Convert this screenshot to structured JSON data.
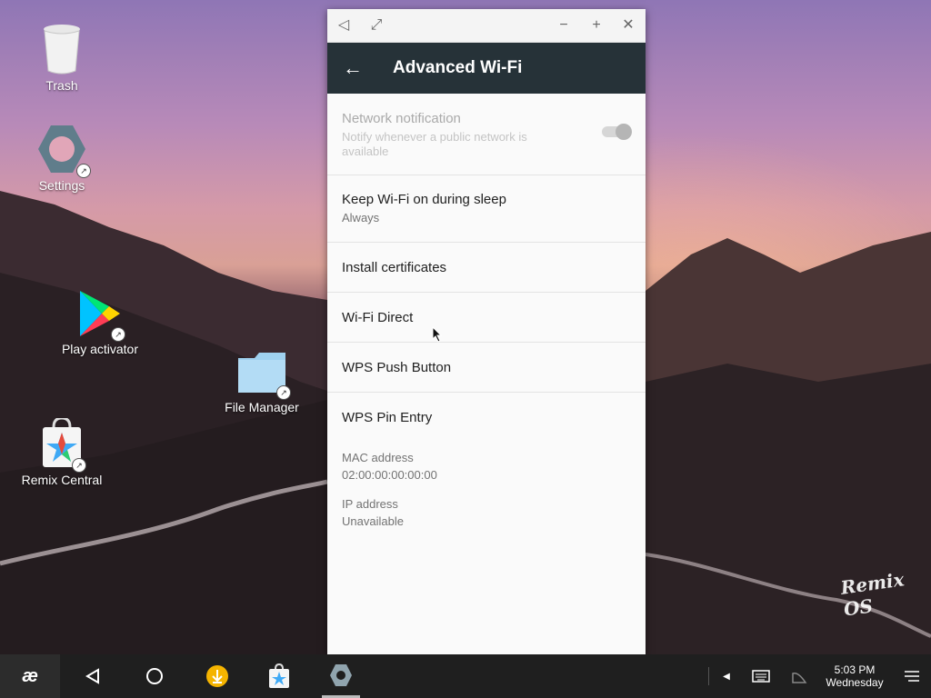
{
  "desktop": {
    "icons": [
      {
        "label": "Trash",
        "icon": "trash-icon"
      },
      {
        "label": "Settings",
        "icon": "settings-icon"
      },
      {
        "label": "Play activator",
        "icon": "play-store-icon"
      },
      {
        "label": "File Manager",
        "icon": "folder-icon"
      },
      {
        "label": "Remix Central",
        "icon": "remix-central-icon"
      }
    ],
    "watermark": "Remix OS"
  },
  "window": {
    "controls": [
      "back-triangle-icon",
      "fullscreen-icon",
      "minimize-icon",
      "maximize-icon",
      "close-icon"
    ],
    "appbar": {
      "title": "Advanced Wi-Fi",
      "back_icon": "arrow-back-icon"
    },
    "settings": [
      {
        "title": "Network notification",
        "summary": "Notify whenever a public network is available",
        "disabled": true,
        "toggle": true
      },
      {
        "title": "Keep Wi-Fi on during sleep",
        "summary": "Always"
      },
      {
        "title": "Install certificates"
      },
      {
        "title": "Wi-Fi Direct"
      },
      {
        "title": "WPS Push Button"
      },
      {
        "title": "WPS Pin Entry"
      }
    ],
    "info": [
      {
        "label": "MAC address",
        "value": "02:00:00:00:00:00"
      },
      {
        "label": "IP address",
        "value": "Unavailable"
      }
    ]
  },
  "taskbar": {
    "start_icon": "remix-start-icon",
    "nav": [
      "back-icon",
      "home-icon"
    ],
    "apps": [
      "downloader-icon",
      "remix-central-icon",
      "settings-icon"
    ],
    "tray": [
      "tray-arrow-icon",
      "keyboard-icon",
      "signal-icon",
      "notifications-icon"
    ],
    "clock": {
      "time": "5:03 PM",
      "day": "Wednesday"
    },
    "colors": {
      "background": "#1f1f1f",
      "downloader": "#f5b400"
    }
  },
  "colors": {
    "appbar": "#263238",
    "window_bg": "#fafafa"
  }
}
